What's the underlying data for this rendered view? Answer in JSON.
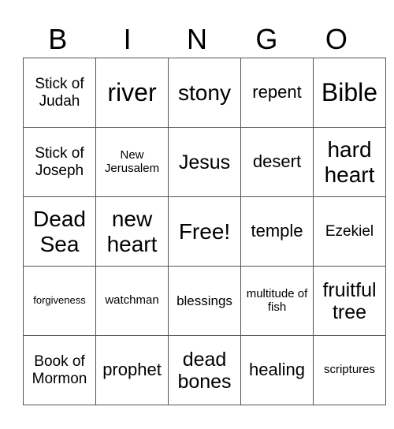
{
  "header": [
    "B",
    "I",
    "N",
    "G",
    "O"
  ],
  "rows": [
    [
      "Stick of Judah",
      "river",
      "stony",
      "repent",
      "Bible"
    ],
    [
      "Stick of Joseph",
      "New Jerusalem",
      "Jesus",
      "desert",
      "hard heart"
    ],
    [
      "Dead Sea",
      "new heart",
      "Free!",
      "temple",
      "Ezekiel"
    ],
    [
      "forgiveness",
      "watchman",
      "blessings",
      "multitude of fish",
      "fruitful tree"
    ],
    [
      "Book of Mormon",
      "prophet",
      "dead bones",
      "healing",
      "scriptures"
    ]
  ]
}
